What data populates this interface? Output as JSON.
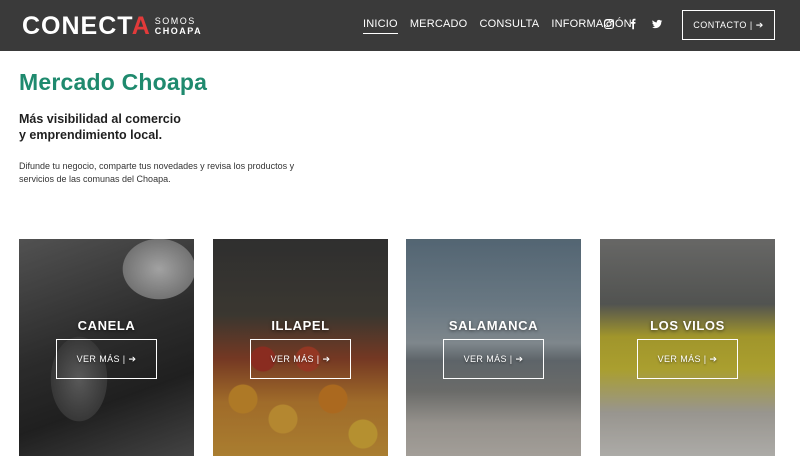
{
  "header": {
    "logo_main": "CONECT",
    "logo_accent": "A",
    "logo_sub_top": "SOMOS",
    "logo_sub_bottom": "CHOAPA",
    "nav": [
      {
        "label": "INICIO",
        "active": true
      },
      {
        "label": "MERCADO",
        "active": false
      },
      {
        "label": "CONSULTA",
        "active": false
      },
      {
        "label": "INFORMACIÓN",
        "active": false
      }
    ],
    "social_icons": [
      "instagram-icon",
      "facebook-icon",
      "twitter-icon"
    ],
    "contact_label": "CONTACTO | ➔"
  },
  "hero": {
    "title": "Mercado Choapa",
    "subtitle_line1": "Más visibilidad al comercio",
    "subtitle_line2": "y emprendimiento local.",
    "description": "Difunde tu negocio, comparte tus novedades y revisa los productos y servicios de las comunas del Choapa."
  },
  "cards": [
    {
      "name": "CANELA",
      "button": "VER MÁS | ➔"
    },
    {
      "name": "ILLAPEL",
      "button": "VER MÁS | ➔"
    },
    {
      "name": "SALAMANCA",
      "button": "VER MÁS | ➔"
    },
    {
      "name": "LOS VILOS",
      "button": "VER MÁS | ➔"
    }
  ],
  "colors": {
    "header_bg": "#3a3a3a",
    "title_green": "#1f8a6e",
    "logo_accent": "#e23a3a"
  }
}
